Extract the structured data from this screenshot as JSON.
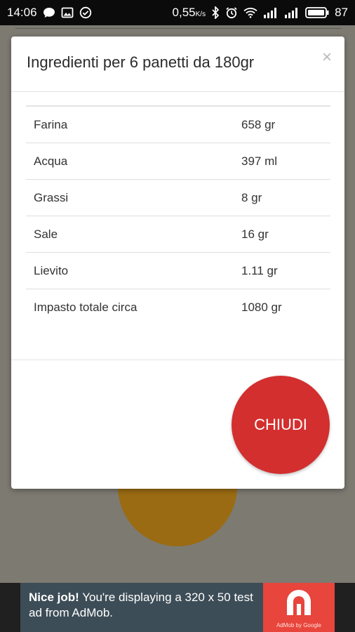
{
  "status_bar": {
    "time": "14:06",
    "data_rate": "0,55",
    "data_rate_unit": "K/s",
    "battery": "87",
    "icons_left": [
      "chat-icon",
      "image-icon",
      "check-circle-icon"
    ],
    "icons_right": [
      "bluetooth-icon",
      "alarm-icon",
      "wifi-icon",
      "signal-icon",
      "signal-icon",
      "battery-icon"
    ]
  },
  "dialog": {
    "title": "Ingredienti per 6 panetti da 180gr",
    "close_label": "×",
    "rows": [
      {
        "name": "Farina",
        "value": "658 gr"
      },
      {
        "name": "Acqua",
        "value": "397 ml"
      },
      {
        "name": "Grassi",
        "value": "8 gr"
      },
      {
        "name": "Sale",
        "value": "16 gr"
      },
      {
        "name": "Lievito",
        "value": "1.11 gr"
      },
      {
        "name": "Impasto totale circa",
        "value": "1080 gr"
      }
    ],
    "button_label": "CHIUDI",
    "button_color": "#d32f2f"
  },
  "ad": {
    "headline": "Nice job!",
    "text": "You're displaying a 320 x 50 test ad from AdMob.",
    "logo_caption": "AdMob by Google",
    "colors": {
      "background": "#3d4d57",
      "logo": "#e8453c"
    }
  },
  "background": {
    "accent_circle_color": "#9a6b12"
  }
}
